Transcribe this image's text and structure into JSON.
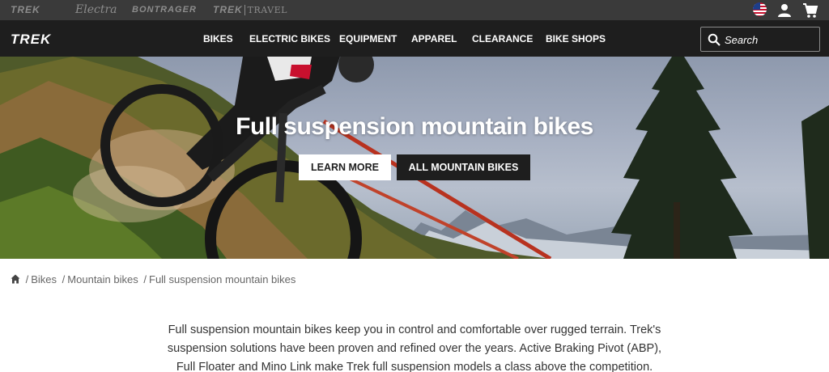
{
  "brand_bar": {
    "brands": [
      "TREK",
      "Electra",
      "BONTRAGER",
      "TREK",
      "TRAVEL"
    ]
  },
  "nav": {
    "logo": "TREK",
    "items": [
      "BIKES",
      "ELECTRIC BIKES",
      "EQUIPMENT",
      "APPAREL",
      "CLEARANCE",
      "BIKE SHOPS"
    ],
    "search_placeholder": "Search"
  },
  "hero": {
    "title": "Full suspension mountain bikes",
    "primary_button": "LEARN MORE",
    "secondary_button": "ALL MOUNTAIN BIKES"
  },
  "breadcrumb": {
    "items": [
      "Bikes",
      "Mountain bikes",
      "Full suspension mountain bikes"
    ]
  },
  "intro": {
    "text": "Full suspension mountain bikes keep you in control and comfortable over rugged terrain. Trek's suspension solutions have been proven and refined over the years. Active Braking Pivot (ABP), Full Floater and Mino Link make Trek full suspension models a class above the competition."
  },
  "colors": {
    "brand_bar_bg": "#3a3a3a",
    "nav_bg": "#1e1e1e",
    "accent_red": "#c8102e"
  },
  "icons": [
    "us-flag-icon",
    "user-icon",
    "cart-icon",
    "search-icon",
    "home-icon"
  ]
}
